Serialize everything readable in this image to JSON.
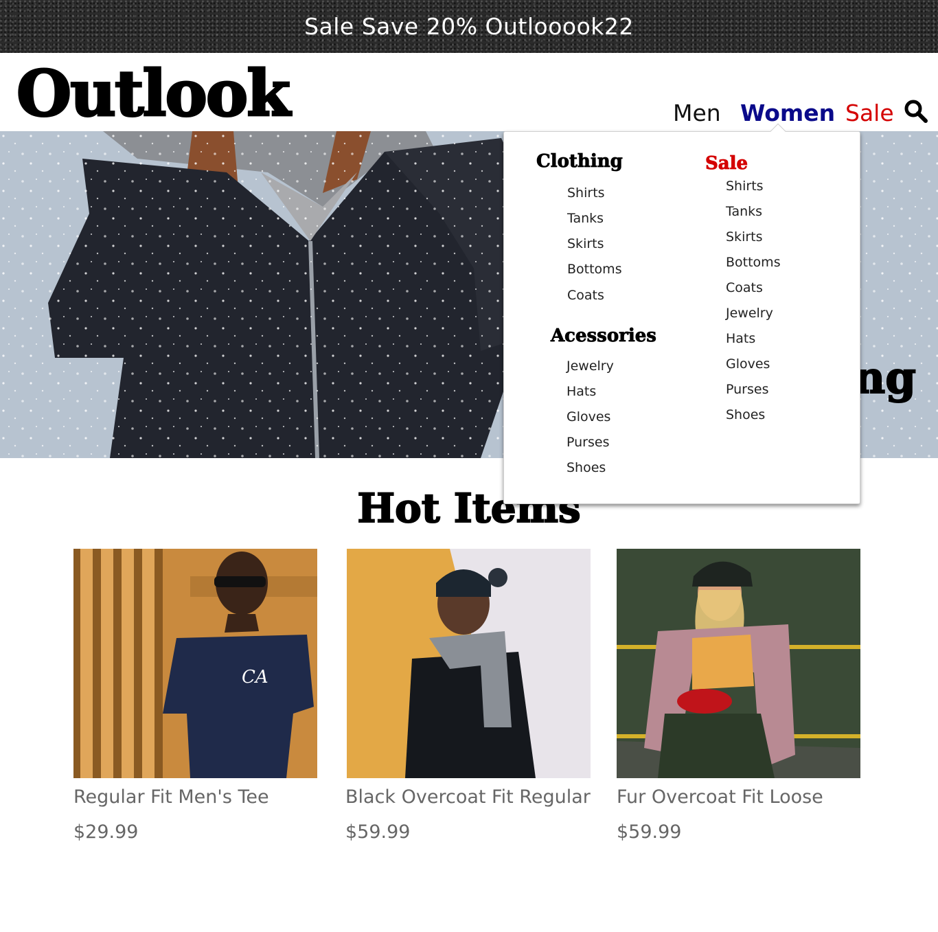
{
  "promo": {
    "text": "Sale Save 20% Outlooook22"
  },
  "header": {
    "logo": "Outlook",
    "nav": {
      "men": "Men",
      "women": "Women",
      "sale": "Sale"
    },
    "search_icon": "search-icon"
  },
  "hero": {
    "heading_fragment": "ng"
  },
  "dropdown": {
    "clothing": {
      "heading": "Clothing",
      "items": [
        "Shirts",
        "Tanks",
        "Skirts",
        "Bottoms",
        "Coats"
      ]
    },
    "accessories": {
      "heading": "Acessories",
      "items": [
        "Jewelry",
        "Hats",
        "Gloves",
        "Purses",
        "Shoes"
      ]
    },
    "sale": {
      "heading": "Sale",
      "items": [
        "Shirts",
        "Tanks",
        "Skirts",
        "Bottoms",
        "Coats",
        "Jewelry",
        "Hats",
        "Gloves",
        "Purses",
        "Shoes"
      ]
    }
  },
  "hot_items": {
    "title": "Hot Items",
    "products": [
      {
        "name": "Regular Fit Men's Tee",
        "price": "$29.99"
      },
      {
        "name": "Black Overcoat Fit Regular",
        "price": "$59.99"
      },
      {
        "name": "Fur Overcoat Fit Loose",
        "price": "$59.99"
      }
    ]
  },
  "colors": {
    "nav_active": "#0a0a8a",
    "sale_red": "#d40000",
    "product_text": "#666666"
  }
}
